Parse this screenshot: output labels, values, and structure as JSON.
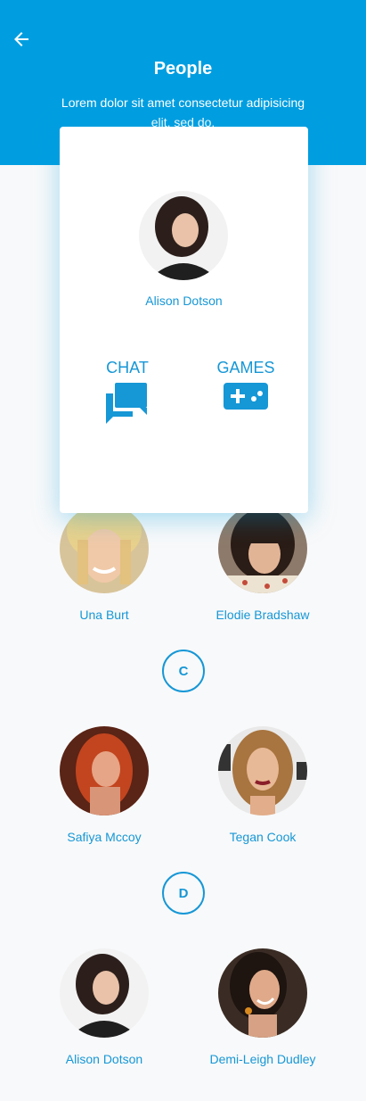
{
  "header": {
    "title": "People",
    "subtitle": "Lorem dolor sit amet consectetur adipisicing elit, sed do."
  },
  "card": {
    "name": "Alison Dotson",
    "actions": [
      {
        "label": "CHAT",
        "icon": "chat-icon"
      },
      {
        "label": "GAMES",
        "icon": "gamepad-icon"
      }
    ]
  },
  "sections": [
    {
      "people": [
        {
          "name": "Una Burt"
        },
        {
          "name": "Elodie Bradshaw"
        }
      ]
    },
    {
      "letter": "C",
      "people": [
        {
          "name": "Safiya Mccoy"
        },
        {
          "name": "Tegan Cook"
        }
      ]
    },
    {
      "letter": "D",
      "people": [
        {
          "name": "Alison Dotson"
        },
        {
          "name": "Demi-Leigh Dudley"
        }
      ]
    }
  ],
  "colors": {
    "accent": "#009ee0",
    "text_accent": "#1697d6",
    "background": "#f8f9fa"
  }
}
